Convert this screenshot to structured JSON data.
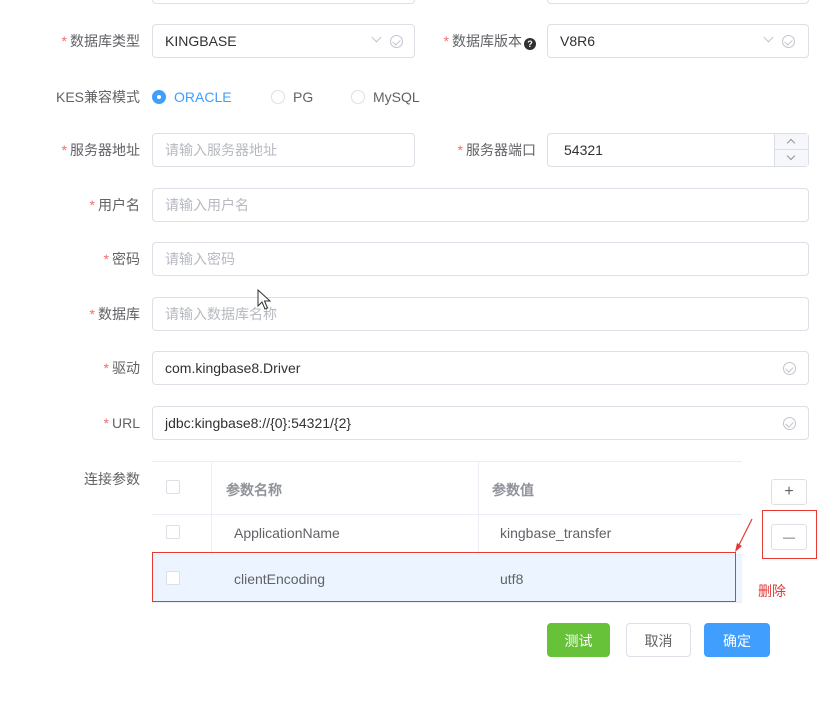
{
  "form": {
    "db_type": {
      "label": "数据库类型",
      "value": "KINGBASE"
    },
    "db_version": {
      "label": "数据库版本",
      "value": "V8R6",
      "help_icon": "question-circle-icon"
    },
    "compat_mode": {
      "label": "KES兼容模式",
      "options": [
        "ORACLE",
        "PG",
        "MySQL"
      ],
      "selected": "ORACLE"
    },
    "server_address": {
      "label": "服务器地址",
      "placeholder": "请输入服务器地址"
    },
    "server_port": {
      "label": "服务器端口",
      "value": "54321"
    },
    "username": {
      "label": "用户名",
      "placeholder": "请输入用户名"
    },
    "password": {
      "label": "密码",
      "placeholder": "请输入密码"
    },
    "database": {
      "label": "数据库",
      "placeholder": "请输入数据库名称"
    },
    "driver": {
      "label": "驱动",
      "value": "com.kingbase8.Driver"
    },
    "url": {
      "label": "URL",
      "value": "jdbc:kingbase8://{0}:54321/{2}"
    },
    "conn_params": {
      "label": "连接参数",
      "columns": [
        "参数名称",
        "参数值"
      ],
      "rows": [
        {
          "name": "ApplicationName",
          "value": "kingbase_transfer"
        },
        {
          "name": "clientEncoding",
          "value": "utf8"
        }
      ],
      "add_symbol": "+",
      "remove_symbol": "—"
    }
  },
  "annotation": {
    "text": "删除",
    "color": "#e53935"
  },
  "buttons": {
    "test": "测试",
    "cancel": "取消",
    "confirm": "确定"
  },
  "colors": {
    "primary": "#409eff",
    "success": "#67c23a",
    "required": "#f56c6c"
  }
}
